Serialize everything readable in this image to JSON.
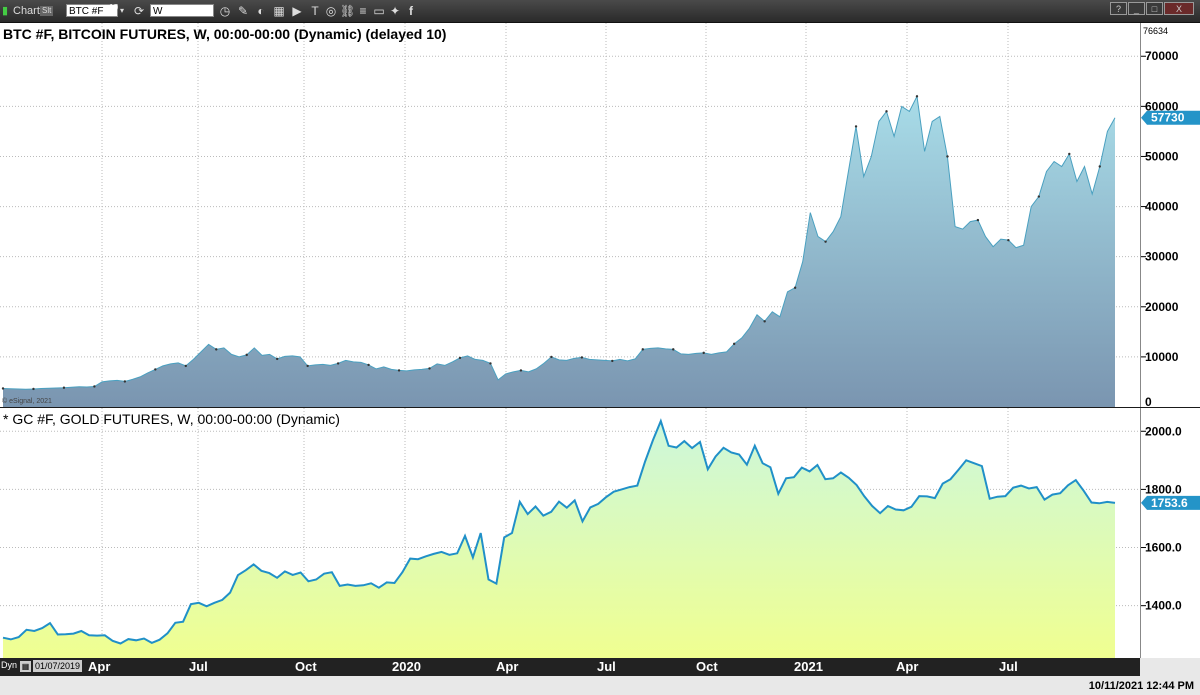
{
  "toolbar": {
    "chart_label": "Chart",
    "link_badge": "Slt",
    "symbol": "BTC #F",
    "symbol_count": "10",
    "interval": "W",
    "icons": [
      "clock-icon",
      "pencil-icon",
      "chart-icon",
      "grid-icon",
      "play-icon",
      "t-icon",
      "target-icon",
      "link-icon",
      "list-icon",
      "chat-icon",
      "twitter-icon",
      "facebook-icon"
    ],
    "window_buttons": [
      "?",
      "_",
      "□",
      "X"
    ]
  },
  "colors": {
    "btc_fill_top": "#a8dce8",
    "btc_fill_bottom": "#7a95b0",
    "btc_line": "#4aa0c0",
    "gold_fill_top": "#ccf7dc",
    "gold_fill_bottom": "#f0ff90",
    "gold_line": "#2090c8",
    "tag_bg": "#2494c8",
    "grid": "#bbbbbb"
  },
  "chart_data": [
    {
      "type": "area",
      "title": "BTC #F, BITCOIN FUTURES, W, 00:00-00:00 (Dynamic) (delayed 10)",
      "copyright": "© eSignal, 2021",
      "ylim": [
        0,
        76634
      ],
      "ymax_label": "76634",
      "yticks": [
        0,
        10000,
        20000,
        30000,
        40000,
        50000,
        60000,
        70000
      ],
      "last_value": "57730",
      "last_value_num": 57730,
      "values": [
        3700,
        3650,
        3600,
        3550,
        3600,
        3700,
        3750,
        3800,
        3850,
        3950,
        4050,
        4000,
        4100,
        5000,
        5200,
        5300,
        5100,
        5500,
        6000,
        6800,
        7500,
        8200,
        8600,
        8800,
        8200,
        9500,
        11000,
        12500,
        11500,
        11800,
        10500,
        10000,
        10400,
        11800,
        10300,
        10500,
        9600,
        10100,
        10200,
        10000,
        8200,
        8400,
        8500,
        8300,
        8700,
        9300,
        9000,
        8900,
        8400,
        7600,
        8000,
        7500,
        7300,
        7200,
        7400,
        7500,
        7700,
        8600,
        8300,
        9000,
        9800,
        10200,
        9500,
        9300,
        8700,
        5400,
        6600,
        7000,
        7300,
        7000,
        7600,
        8700,
        10000,
        9400,
        9300,
        9700,
        9900,
        9500,
        9400,
        9300,
        9200,
        9500,
        9200,
        9600,
        11500,
        11700,
        11800,
        11600,
        11500,
        10600,
        10500,
        10700,
        10800,
        10500,
        10800,
        11000,
        12600,
        13800,
        15700,
        18400,
        17100,
        19000,
        18000,
        23000,
        23800,
        29000,
        38800,
        34000,
        33000,
        35000,
        38000,
        47000,
        56000,
        46000,
        50000,
        57000,
        59000,
        54000,
        60000,
        59000,
        62000,
        51000,
        57000,
        58000,
        50000,
        36000,
        35500,
        37000,
        37300,
        34000,
        32000,
        33500,
        33300,
        31800,
        32300,
        40000,
        42000,
        47000,
        49000,
        48000,
        50500,
        45000,
        48000,
        42500,
        48000,
        55000,
        57730
      ]
    },
    {
      "type": "line",
      "title": "* GC #F, GOLD FUTURES, W, 00:00-00:00 (Dynamic)",
      "ylim": [
        1220,
        2080
      ],
      "yticks": [
        1400,
        1600,
        1800,
        2000
      ],
      "ytick_labels": [
        "1400.0",
        "1600.0",
        "1800.0",
        "2000.0"
      ],
      "last_value": "1753.6",
      "last_value_num": 1753.6,
      "values": [
        1290,
        1284,
        1292,
        1317,
        1313,
        1323,
        1340,
        1301,
        1302,
        1304,
        1313,
        1298,
        1297,
        1298,
        1279,
        1270,
        1285,
        1281,
        1287,
        1272,
        1283,
        1305,
        1341,
        1345,
        1405,
        1410,
        1398,
        1410,
        1420,
        1445,
        1505,
        1522,
        1542,
        1520,
        1512,
        1496,
        1518,
        1506,
        1514,
        1484,
        1490,
        1510,
        1515,
        1468,
        1473,
        1468,
        1470,
        1477,
        1462,
        1480,
        1478,
        1515,
        1562,
        1560,
        1570,
        1578,
        1585,
        1575,
        1580,
        1640,
        1566,
        1650,
        1490,
        1476,
        1635,
        1650,
        1757,
        1715,
        1741,
        1710,
        1723,
        1758,
        1737,
        1762,
        1690,
        1738,
        1750,
        1773,
        1792,
        1800,
        1808,
        1813,
        1896,
        1970,
        2035,
        1950,
        1944,
        1966,
        1942,
        1963,
        1869,
        1913,
        1943,
        1927,
        1920,
        1885,
        1950,
        1890,
        1876,
        1785,
        1838,
        1842,
        1875,
        1862,
        1884,
        1835,
        1838,
        1858,
        1840,
        1815,
        1776,
        1743,
        1718,
        1743,
        1731,
        1728,
        1740,
        1777,
        1776,
        1770,
        1820,
        1835,
        1867,
        1900,
        1890,
        1880,
        1768,
        1775,
        1777,
        1806,
        1813,
        1803,
        1808,
        1765,
        1782,
        1787,
        1814,
        1832,
        1795,
        1755,
        1752,
        1757,
        1753.6
      ]
    }
  ],
  "x_axis": {
    "date_box": "01/07/2019",
    "dyn_label": "Dyn",
    "labels": [
      "Apr",
      "Jul",
      "Oct",
      "2020",
      "Apr",
      "Jul",
      "Oct",
      "2021",
      "Apr",
      "Jul"
    ]
  },
  "status_text": "10/11/2021 12:44 PM"
}
